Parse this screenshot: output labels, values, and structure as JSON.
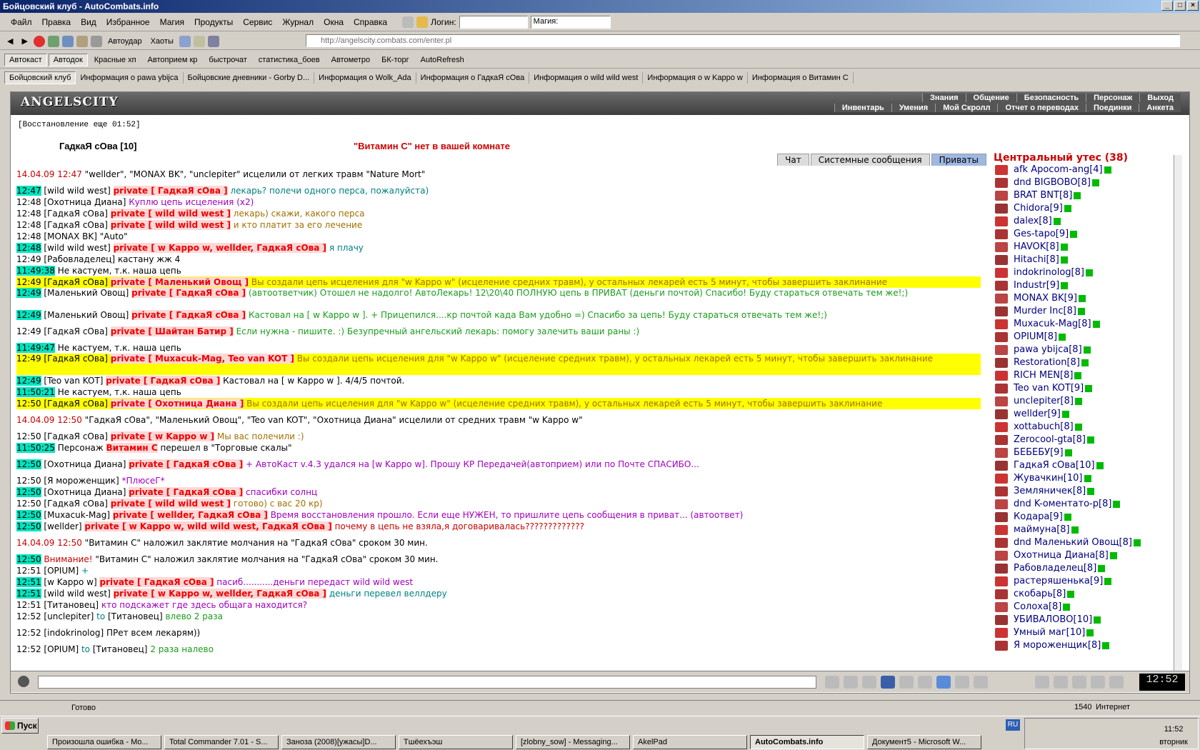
{
  "window": {
    "title": "Бойцовский клуб - AutoCombats.info",
    "controls": [
      "_",
      "□",
      "×"
    ]
  },
  "menu": {
    "items": [
      "Файл",
      "Правка",
      "Вид",
      "Избранное",
      "Магия",
      "Продукты",
      "Сервис",
      "Журнал",
      "Окна",
      "Справка"
    ],
    "login_label": "Логин:",
    "magic_label": "Магия:"
  },
  "nav": {
    "autoudar": "Автоудар",
    "haoty": "Хаоты",
    "address": "http://angelscity.combats.com/enter.pl"
  },
  "links": [
    "Автокаст",
    "Автодок",
    "Красные хп",
    "Автоприем кр",
    "быстрочат",
    "статистика_боев",
    "Автометро",
    "БК-торг",
    "AutoRefresh"
  ],
  "favs": [
    "Бойцовский клуб",
    "Информация о pawa ybijca",
    "Бойцовские дневники - Gorby D...",
    "Информация о Wolk_Ada",
    "Информация о ГадкаЯ сОва",
    "Информация о wild wild west",
    "Информация о w Kappo w",
    "Информация о Витамин С"
  ],
  "game": {
    "logo": "ANGELSCITY",
    "topmenu1": [
      "Знания",
      "Общение",
      "Безопасность",
      "Персонаж",
      "Выход"
    ],
    "topmenu2": [
      "Инвентарь",
      "Умения",
      "Мой Скролл",
      "Отчет о переводах",
      "Поединки",
      "Анкета"
    ],
    "restore": "[Восстановление еще 01:52]",
    "hdr_nick": "ГадкаЯ сОва [10]",
    "silence": "\"Витамин С\" нет в вашей комнате",
    "tabs": [
      "Чат",
      "Системные сообщения",
      "Приваты"
    ]
  },
  "sidebar": {
    "title": "Центральный утес (38)",
    "users": [
      "afk Apocom-ang[4]",
      "dnd BIGBOBO[8]",
      "BRAT BNT[8]",
      "Chidora[9]",
      "dalex[8]",
      "Ges-tapo[9]",
      "HAVOK[8]",
      "Hitachi[8]",
      "indokrinolog[8]",
      "Industr[9]",
      "MONAX BK[9]",
      "Murder Inc[8]",
      "Muxacuk-Mag[8]",
      "OPIUM[8]",
      "pawa ybijca[8]",
      "Restoration[8]",
      "RICH MEN[8]",
      "Teo van KOT[9]",
      "unclepiter[8]",
      "wellder[9]",
      "xottabuch[8]",
      "Zerocool-gta[8]",
      "БЕБЕБУ[9]",
      "ГадкаЯ сОва[10]",
      "Жувачкин[10]",
      "Земляничек[8]",
      "dnd K-оментато-р[8]",
      "Кодара[9]",
      "маймуна[8]",
      "dnd Маленький Овощ[8]",
      "Охотница Диана[8]",
      "Рабовладелец[8]",
      "растеряшенька[9]",
      "скобарь[8]",
      "Солоха[8]",
      "УБИВАЛОВО[10]",
      "Умный маг[10]",
      "Я мороженщик[8]"
    ]
  },
  "chat": [
    {
      "time": "14.04.09 12:47",
      "tc": "tr",
      "parts": [
        [
          "t",
          " \"wellder\", \"MONAX BK\", \"unclepiter\" исцелили от легких травм \"Nature Mort\""
        ]
      ],
      "cls": "tall"
    },
    {
      "time": "12:47",
      "tc": "tg",
      "parts": [
        [
          "nick",
          "[wild wild west] "
        ],
        [
          "prv",
          "private [ ГадкаЯ сОва ]"
        ],
        [
          "m",
          " лекарь? полечи одного перса, пожалуйста)"
        ]
      ]
    },
    {
      "time": "12:48",
      "tc": "t",
      "parts": [
        [
          "nick",
          "[Охотница Диана] "
        ],
        [
          "mp",
          "Куплю цепь исцеления (х2)"
        ]
      ]
    },
    {
      "time": "12:48",
      "tc": "t",
      "parts": [
        [
          "nick",
          "[ГадкаЯ сОва] "
        ],
        [
          "prv",
          "private [ wild wild west ]"
        ],
        [
          "mo",
          " лекарь) скажи, какого перса"
        ]
      ]
    },
    {
      "time": "12:48",
      "tc": "t",
      "parts": [
        [
          "nick",
          "[ГадкаЯ сОва] "
        ],
        [
          "prv",
          "private [ wild wild west ]"
        ],
        [
          "mo",
          " и кто платит за его лечение"
        ]
      ]
    },
    {
      "time": "12:48",
      "tc": "t",
      "parts": [
        [
          "nick",
          "[MONAX BK] "
        ],
        [
          "t",
          "\"Auto\""
        ]
      ]
    },
    {
      "time": "12:48",
      "tc": "tg",
      "parts": [
        [
          "nick",
          "[wild wild west] "
        ],
        [
          "prv",
          "private [ w Kappo w, wellder, ГадкаЯ сОва ]"
        ],
        [
          "m",
          " я плачу"
        ]
      ]
    },
    {
      "time": "12:49",
      "tc": "t",
      "parts": [
        [
          "nick",
          "[Рабовладелец] "
        ],
        [
          "t",
          "кастану жж 4"
        ]
      ]
    },
    {
      "time": "11:49:38",
      "tc": "tg",
      "parts": [
        [
          "t",
          "Не кастуем, т.к. наша цепь"
        ]
      ]
    },
    {
      "time": "12:49",
      "tc": "t",
      "cls": "ygl",
      "parts": [
        [
          "nick",
          "[ГадкаЯ сОва] "
        ],
        [
          "prv",
          "private [ Маленький Овощ ]"
        ],
        [
          "mo",
          " Вы создали цепь исцеления для \"w Kappo w\" (исцеление средних травм), у остальных лекарей есть 5 минут, чтобы завершить заклинание"
        ]
      ]
    },
    {
      "time": "12:49",
      "tc": "tg",
      "cls": "tall2",
      "parts": [
        [
          "nick",
          "[Маленький Овощ] "
        ],
        [
          "prv",
          "private [ ГадкаЯ сОва ]"
        ],
        [
          "mg",
          " (автоответчик) Отошел не надолго! АвтоЛекарь! 12\\20\\40 ПОЛНУЮ цепь в ПРИВАТ (деньги почтой) Спасибо! Буду стараться отвечать тем же!;)"
        ]
      ]
    },
    {
      "time": "12:49",
      "tc": "tg",
      "parts": [
        [
          "nick",
          "[Маленький Овощ] "
        ],
        [
          "prv",
          "private [ ГадкаЯ сОва ]"
        ],
        [
          "mg",
          " Кастовал на [ w Kappo w ]. + Прицепился....кр почтой када Вам удобно =) Спасибо за цепь! Буду стараться отвечать тем же!;)"
        ]
      ]
    },
    {
      "time": "12:49",
      "tc": "t",
      "cls": "tall",
      "parts": [
        [
          "nick",
          "[ГадкаЯ сОва] "
        ],
        [
          "prv",
          "private [ Шайтан Батир ]"
        ],
        [
          "mg",
          "        Если нужна - пишите. :) Безупречный ангельский лекарь: помогу залечить ваши раны :)"
        ]
      ]
    },
    {
      "time": "11:49:47",
      "tc": "tg",
      "parts": [
        [
          "t",
          "Не кастуем, т.к. наша цепь"
        ]
      ]
    },
    {
      "time": "12:49",
      "tc": "t",
      "cls": "ygl tall2",
      "parts": [
        [
          "nick",
          "[ГадкаЯ сОва] "
        ],
        [
          "prv",
          "private [ Muxacuk-Mag, Teo van KOT ]"
        ],
        [
          "mo",
          " Вы создали цепь исцеления для \"w Kappo w\" (исцеление средних травм), у остальных лекарей есть 5 минут, чтобы завершить заклинание"
        ]
      ]
    },
    {
      "time": "12:49",
      "tc": "tg",
      "parts": [
        [
          "nick",
          "[Teo van KOT] "
        ],
        [
          "prv",
          "private [ ГадкаЯ сОва ]"
        ],
        [
          "t",
          " Кастовал на [ w Kappo w ]. 4/4/5 почтой."
        ]
      ]
    },
    {
      "time": "11:50:21",
      "tc": "tg",
      "parts": [
        [
          "t",
          "Не кастуем, т.к. наша цепь"
        ]
      ]
    },
    {
      "time": "12:50",
      "tc": "t",
      "cls": "ygl",
      "parts": [
        [
          "nick",
          "[ГадкаЯ сОва] "
        ],
        [
          "prv",
          "private [ Охотница Диана ]"
        ],
        [
          "mo",
          " Вы создали цепь исцеления для \"w Kappo w\" (исцеление средних травм), у остальных лекарей есть 5 минут, чтобы завершить заклинание"
        ]
      ]
    },
    {
      "time": "14.04.09 12:50",
      "tc": "tr",
      "cls": "tall",
      "parts": [
        [
          "t",
          "         \"ГадкаЯ сОва\", \"Маленький Овощ\", \"Teo van KOT\", \"Охотница Диана\" исцелили от средних травм \"w Kappo w\""
        ]
      ]
    },
    {
      "time": "12:50",
      "tc": "t",
      "parts": [
        [
          "nick",
          "[ГадкаЯ сОва] "
        ],
        [
          "prv",
          "private [ w Kappo w ]"
        ],
        [
          "mo",
          " Мы вас полечили :)"
        ]
      ]
    },
    {
      "time": "11:50:25",
      "tc": "tg",
      "parts": [
        [
          "t",
          "Персонаж "
        ],
        [
          "prv",
          "Витамин С"
        ],
        [
          "t",
          " перешел в \"Торговые скалы\""
        ]
      ]
    },
    {
      "time": "12:50",
      "tc": "tg",
      "cls": "tall",
      "parts": [
        [
          "nick",
          "[Охотница Диана] "
        ],
        [
          "prv",
          "private [ ГадкаЯ сОва ]"
        ],
        [
          "mp",
          " + АвтоКаст v.4.3 удался на [w Kappo w]. Прошу КР Передачей(автоприем) или по Почте        СПАСИБО..."
        ]
      ]
    },
    {
      "time": "12:50",
      "tc": "t",
      "parts": [
        [
          "nick",
          "[Я мороженщик] "
        ],
        [
          "mp",
          "*ПлюсеГ*"
        ]
      ]
    },
    {
      "time": "12:50",
      "tc": "tg",
      "parts": [
        [
          "nick",
          "[Охотница Диана] "
        ],
        [
          "prv",
          "private [ ГадкаЯ сОва ]"
        ],
        [
          "mp",
          " спасибки солнц"
        ]
      ]
    },
    {
      "time": "12:50",
      "tc": "t",
      "parts": [
        [
          "nick",
          "[ГадкаЯ сОва] "
        ],
        [
          "prv",
          "private [ wild wild west ]"
        ],
        [
          "mo",
          " готово) с вас 20 кр)"
        ]
      ]
    },
    {
      "time": "12:50",
      "tc": "tg",
      "parts": [
        [
          "nick",
          "[Muxacuk-Mag] "
        ],
        [
          "prv",
          "private [ wellder, ГадкаЯ сОва ]"
        ],
        [
          "mp",
          " Время восстановления прошло. Если еще НУЖЕН, то пришлите цепь сообщения в приват... (автоответ)"
        ]
      ]
    },
    {
      "time": "12:50",
      "tc": "tg",
      "parts": [
        [
          "nick",
          "[wellder] "
        ],
        [
          "prv",
          "private [ w Kappo w, wild wild west, ГадкаЯ сОва ]"
        ],
        [
          "tr",
          " почему в цепь не взяла,я договаривалась?????????????"
        ]
      ]
    },
    {
      "time": "14.04.09 12:50",
      "tc": "tr",
      "cls": "tall",
      "parts": [
        [
          "t",
          "         \"Витамин С\" наложил заклятие молчания на \"ГадкаЯ сОва\" сроком 30 мин."
        ]
      ]
    },
    {
      "time": "12:50",
      "tc": "tg",
      "parts": [
        [
          "tr",
          "Внимание! "
        ],
        [
          "t",
          "\"Витамин С\" наложил заклятие молчания на \"ГадкаЯ сОва\" сроком 30 мин."
        ]
      ]
    },
    {
      "time": "12:51",
      "tc": "t",
      "parts": [
        [
          "nick",
          "[OPIUM] "
        ],
        [
          "m",
          "+"
        ]
      ]
    },
    {
      "time": "12:51",
      "tc": "tg",
      "parts": [
        [
          "nick",
          "[w Kappo w] "
        ],
        [
          "prv",
          "private [ ГадкаЯ сОва ]"
        ],
        [
          "mp",
          " пасиб...........деньги передаст wild wild west"
        ]
      ]
    },
    {
      "time": "12:51",
      "tc": "tg",
      "parts": [
        [
          "nick",
          "[wild wild west] "
        ],
        [
          "prv",
          "private [ w Kappo w, wellder, ГадкаЯ сОва ]"
        ],
        [
          "m",
          " деньги перевел веллдеру"
        ]
      ]
    },
    {
      "time": "12:51",
      "tc": "t",
      "parts": [
        [
          "nick",
          "[Титановец] "
        ],
        [
          "mp",
          "кто подскажет где здесь общага находится?"
        ]
      ]
    },
    {
      "time": "12:52",
      "tc": "t",
      "parts": [
        [
          "nick",
          "[unclepiter] "
        ],
        [
          "m",
          "to "
        ],
        [
          "nick",
          "[Титановец] "
        ],
        [
          "mg",
          "влево 2 раза"
        ]
      ]
    },
    {
      "time": "12:52",
      "tc": "t",
      "cls": "tall",
      "parts": [
        [
          "nick",
          "[indokrinolog] "
        ],
        [
          "t",
          "ПРет всем лекарям))"
        ]
      ]
    },
    {
      "time": "12:52",
      "tc": "t",
      "parts": [
        [
          "nick",
          "[OPIUM] "
        ],
        [
          "m",
          "to "
        ],
        [
          "nick",
          "[Титановец] "
        ],
        [
          "mg",
          "2 раза налево"
        ]
      ]
    }
  ],
  "clock": "12:52",
  "status": {
    "text": "Готово",
    "num": "1540",
    "zone": "Интернет"
  },
  "taskbar": {
    "start": "Пуск",
    "lang": "RU",
    "time": "11:52",
    "day": "вторник",
    "tasks": [
      "Произошла ошибка - Mo...",
      "Total Commander 7.01 - S...",
      "Заноза (2008)[ужасы]D...",
      "Тшёехъэш",
      "[zlobny_sow] - Messaging...",
      "AkelPad",
      "AutoCombats.info",
      "Документ5 - Microsoft W..."
    ]
  }
}
